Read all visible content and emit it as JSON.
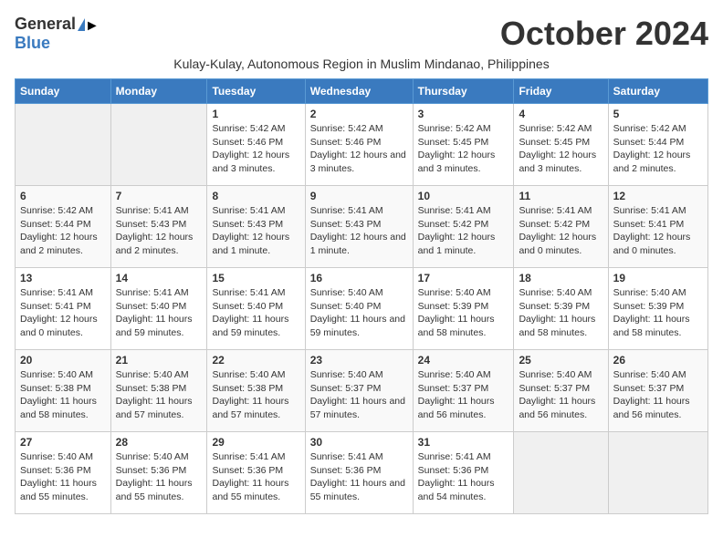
{
  "logo": {
    "general": "General",
    "blue": "Blue"
  },
  "title": "October 2024",
  "subtitle": "Kulay-Kulay, Autonomous Region in Muslim Mindanao, Philippines",
  "days_header": [
    "Sunday",
    "Monday",
    "Tuesday",
    "Wednesday",
    "Thursday",
    "Friday",
    "Saturday"
  ],
  "weeks": [
    [
      {
        "day": "",
        "content": ""
      },
      {
        "day": "",
        "content": ""
      },
      {
        "day": "1",
        "content": "Sunrise: 5:42 AM\nSunset: 5:46 PM\nDaylight: 12 hours and 3 minutes."
      },
      {
        "day": "2",
        "content": "Sunrise: 5:42 AM\nSunset: 5:46 PM\nDaylight: 12 hours and 3 minutes."
      },
      {
        "day": "3",
        "content": "Sunrise: 5:42 AM\nSunset: 5:45 PM\nDaylight: 12 hours and 3 minutes."
      },
      {
        "day": "4",
        "content": "Sunrise: 5:42 AM\nSunset: 5:45 PM\nDaylight: 12 hours and 3 minutes."
      },
      {
        "day": "5",
        "content": "Sunrise: 5:42 AM\nSunset: 5:44 PM\nDaylight: 12 hours and 2 minutes."
      }
    ],
    [
      {
        "day": "6",
        "content": "Sunrise: 5:42 AM\nSunset: 5:44 PM\nDaylight: 12 hours and 2 minutes."
      },
      {
        "day": "7",
        "content": "Sunrise: 5:41 AM\nSunset: 5:43 PM\nDaylight: 12 hours and 2 minutes."
      },
      {
        "day": "8",
        "content": "Sunrise: 5:41 AM\nSunset: 5:43 PM\nDaylight: 12 hours and 1 minute."
      },
      {
        "day": "9",
        "content": "Sunrise: 5:41 AM\nSunset: 5:43 PM\nDaylight: 12 hours and 1 minute."
      },
      {
        "day": "10",
        "content": "Sunrise: 5:41 AM\nSunset: 5:42 PM\nDaylight: 12 hours and 1 minute."
      },
      {
        "day": "11",
        "content": "Sunrise: 5:41 AM\nSunset: 5:42 PM\nDaylight: 12 hours and 0 minutes."
      },
      {
        "day": "12",
        "content": "Sunrise: 5:41 AM\nSunset: 5:41 PM\nDaylight: 12 hours and 0 minutes."
      }
    ],
    [
      {
        "day": "13",
        "content": "Sunrise: 5:41 AM\nSunset: 5:41 PM\nDaylight: 12 hours and 0 minutes."
      },
      {
        "day": "14",
        "content": "Sunrise: 5:41 AM\nSunset: 5:40 PM\nDaylight: 11 hours and 59 minutes."
      },
      {
        "day": "15",
        "content": "Sunrise: 5:41 AM\nSunset: 5:40 PM\nDaylight: 11 hours and 59 minutes."
      },
      {
        "day": "16",
        "content": "Sunrise: 5:40 AM\nSunset: 5:40 PM\nDaylight: 11 hours and 59 minutes."
      },
      {
        "day": "17",
        "content": "Sunrise: 5:40 AM\nSunset: 5:39 PM\nDaylight: 11 hours and 58 minutes."
      },
      {
        "day": "18",
        "content": "Sunrise: 5:40 AM\nSunset: 5:39 PM\nDaylight: 11 hours and 58 minutes."
      },
      {
        "day": "19",
        "content": "Sunrise: 5:40 AM\nSunset: 5:39 PM\nDaylight: 11 hours and 58 minutes."
      }
    ],
    [
      {
        "day": "20",
        "content": "Sunrise: 5:40 AM\nSunset: 5:38 PM\nDaylight: 11 hours and 58 minutes."
      },
      {
        "day": "21",
        "content": "Sunrise: 5:40 AM\nSunset: 5:38 PM\nDaylight: 11 hours and 57 minutes."
      },
      {
        "day": "22",
        "content": "Sunrise: 5:40 AM\nSunset: 5:38 PM\nDaylight: 11 hours and 57 minutes."
      },
      {
        "day": "23",
        "content": "Sunrise: 5:40 AM\nSunset: 5:37 PM\nDaylight: 11 hours and 57 minutes."
      },
      {
        "day": "24",
        "content": "Sunrise: 5:40 AM\nSunset: 5:37 PM\nDaylight: 11 hours and 56 minutes."
      },
      {
        "day": "25",
        "content": "Sunrise: 5:40 AM\nSunset: 5:37 PM\nDaylight: 11 hours and 56 minutes."
      },
      {
        "day": "26",
        "content": "Sunrise: 5:40 AM\nSunset: 5:37 PM\nDaylight: 11 hours and 56 minutes."
      }
    ],
    [
      {
        "day": "27",
        "content": "Sunrise: 5:40 AM\nSunset: 5:36 PM\nDaylight: 11 hours and 55 minutes."
      },
      {
        "day": "28",
        "content": "Sunrise: 5:40 AM\nSunset: 5:36 PM\nDaylight: 11 hours and 55 minutes."
      },
      {
        "day": "29",
        "content": "Sunrise: 5:41 AM\nSunset: 5:36 PM\nDaylight: 11 hours and 55 minutes."
      },
      {
        "day": "30",
        "content": "Sunrise: 5:41 AM\nSunset: 5:36 PM\nDaylight: 11 hours and 55 minutes."
      },
      {
        "day": "31",
        "content": "Sunrise: 5:41 AM\nSunset: 5:36 PM\nDaylight: 11 hours and 54 minutes."
      },
      {
        "day": "",
        "content": ""
      },
      {
        "day": "",
        "content": ""
      }
    ]
  ]
}
